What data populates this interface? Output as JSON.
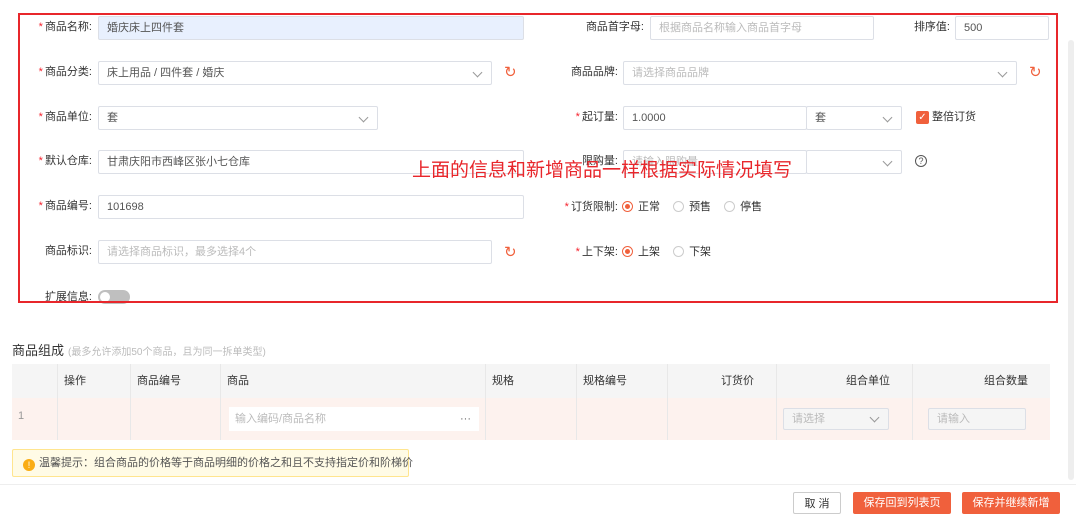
{
  "form": {
    "name_label": "商品名称:",
    "name_value": "婚庆床上四件套",
    "initials_label": "商品首字母:",
    "initials_placeholder": "根据商品名称输入商品首字母",
    "sort_label": "排序值:",
    "sort_value": "500",
    "category_label": "商品分类:",
    "category_value": "床上用品 / 四件套 / 婚庆",
    "brand_label": "商品品牌:",
    "brand_placeholder": "请选择商品品牌",
    "unit_label": "商品单位:",
    "unit_value": "套",
    "min_order_label": "起订量:",
    "min_order_value": "1.0000",
    "min_order_unit": "套",
    "whole_order_label": "整倍订货",
    "warehouse_label": "默认仓库:",
    "warehouse_value": "甘肃庆阳市西峰区张小七仓库",
    "limit_label": "限购量:",
    "limit_placeholder": "请输入限购量",
    "code_label": "商品编号:",
    "code_value": "101698",
    "order_limit_label": "订货限制:",
    "order_limit_options": [
      "正常",
      "预售",
      "停售"
    ],
    "tag_label": "商品标识:",
    "tag_placeholder": "请选择商品标识，最多选择4个",
    "shelf_label": "上下架:",
    "shelf_options": [
      "上架",
      "下架"
    ],
    "ext_label": "扩展信息:"
  },
  "annotation": "上面的信息和新增商品一样根据实际情况填写",
  "composition": {
    "title": "商品组成",
    "hint": "(最多允许添加50个商品，且为同一拆单类型)",
    "columns": [
      "操作",
      "商品编号",
      "商品",
      "规格",
      "规格编号",
      "订货价",
      "组合单位",
      "组合数量"
    ],
    "row_index": "1",
    "product_placeholder": "输入编码/商品名称",
    "more": "···",
    "unit_placeholder": "请选择",
    "qty_placeholder": "请输入"
  },
  "tip": "温馨提示：组合商品的价格等于商品明细的价格之和且不支持指定价和阶梯价",
  "footer": {
    "cancel": "取 消",
    "save_return": "保存回到列表页",
    "save_continue": "保存并继续新增"
  },
  "colors": {
    "accent": "#f0603c",
    "annotation": "#e8262b"
  }
}
